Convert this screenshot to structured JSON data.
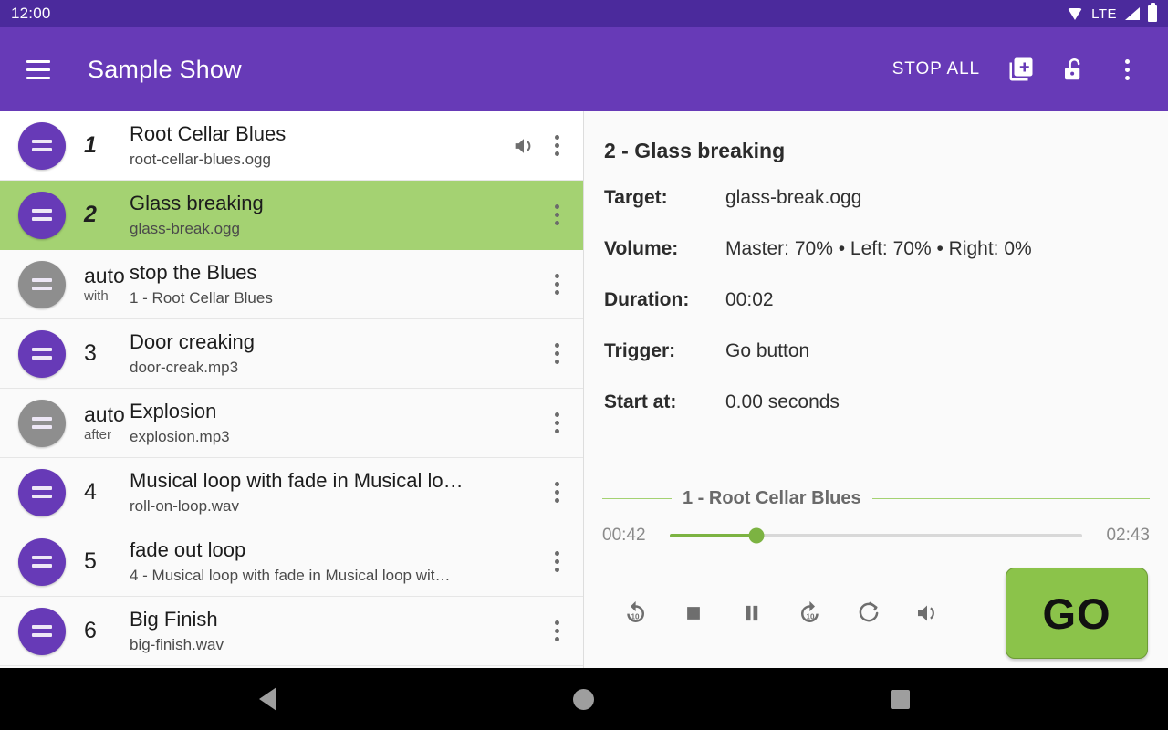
{
  "statusbar": {
    "clock": "12:00",
    "network": "LTE",
    "icons": [
      "wifi-icon",
      "signal-icon",
      "battery-icon"
    ]
  },
  "toolbar": {
    "menu_icon": "hamburger-menu-icon",
    "title": "Sample Show",
    "stop_all_label": "STOP ALL",
    "add_cue_icon": "library-add-icon",
    "lock_icon": "lock-open-icon",
    "overflow_icon": "more-vertical-icon"
  },
  "cuelist": {
    "rows": [
      {
        "handle": "purple",
        "number": "1",
        "number_style": "italic",
        "sub_number": "",
        "title": "Root Cellar Blues",
        "subtitle": "root-cellar-blues.ogg",
        "has_volume_icon": true,
        "selected": false
      },
      {
        "handle": "purple",
        "number": "2",
        "number_style": "italic",
        "sub_number": "",
        "title": "Glass breaking",
        "subtitle": "glass-break.ogg",
        "has_volume_icon": false,
        "selected": true
      },
      {
        "handle": "grey",
        "number": "auto",
        "number_style": "plain",
        "sub_number": "with",
        "title": "stop the Blues",
        "subtitle": "1 - Root Cellar Blues",
        "has_volume_icon": false,
        "selected": false
      },
      {
        "handle": "purple",
        "number": "3",
        "number_style": "plain",
        "sub_number": "",
        "title": "Door creaking",
        "subtitle": "door-creak.mp3",
        "has_volume_icon": false,
        "selected": false
      },
      {
        "handle": "grey",
        "number": "auto",
        "number_style": "plain",
        "sub_number": "after",
        "title": "Explosion",
        "subtitle": "explosion.mp3",
        "has_volume_icon": false,
        "selected": false
      },
      {
        "handle": "purple",
        "number": "4",
        "number_style": "plain",
        "sub_number": "",
        "title": "Musical loop with fade in Musical lo…",
        "subtitle": "roll-on-loop.wav",
        "has_volume_icon": false,
        "selected": false
      },
      {
        "handle": "purple",
        "number": "5",
        "number_style": "plain",
        "sub_number": "",
        "title": "fade out loop",
        "subtitle": "4 - Musical loop with fade in Musical loop wit…",
        "has_volume_icon": false,
        "selected": false
      },
      {
        "handle": "purple",
        "number": "6",
        "number_style": "plain",
        "sub_number": "",
        "title": "Big Finish",
        "subtitle": "big-finish.wav",
        "has_volume_icon": false,
        "selected": false
      }
    ]
  },
  "detail": {
    "title": "2 - Glass breaking",
    "fields": [
      {
        "label": "Target:",
        "value": "glass-break.ogg"
      },
      {
        "label": "Volume:",
        "value": "Master: 70% • Left: 70% • Right: 0%"
      },
      {
        "label": "Duration:",
        "value": "00:02"
      },
      {
        "label": "Trigger:",
        "value": "Go button"
      },
      {
        "label": "Start at:",
        "value": "0.00 seconds"
      }
    ]
  },
  "player": {
    "now_playing": "1 - Root Cellar Blues",
    "elapsed": "00:42",
    "total": "02:43",
    "progress_percent": 21,
    "transport": [
      {
        "icon": "replay-10-icon",
        "label": "Replay 10 seconds"
      },
      {
        "icon": "stop-icon",
        "label": "Stop"
      },
      {
        "icon": "pause-icon",
        "label": "Pause"
      },
      {
        "icon": "forward-10-icon",
        "label": "Forward 10 seconds"
      },
      {
        "icon": "loop-icon",
        "label": "Loop"
      },
      {
        "icon": "volume-icon",
        "label": "Volume"
      }
    ],
    "go_label": "GO"
  },
  "navbar": {
    "back_icon": "nav-back-icon",
    "home_icon": "nav-home-icon",
    "recents_icon": "nav-recents-icon"
  },
  "colors": {
    "status_bar": "#4b2a9c",
    "toolbar": "#673ab7",
    "accent_purple": "#673ab7",
    "selected_green": "#a4d272",
    "go_green": "#8bc34a",
    "progress_green": "#7cb342"
  }
}
